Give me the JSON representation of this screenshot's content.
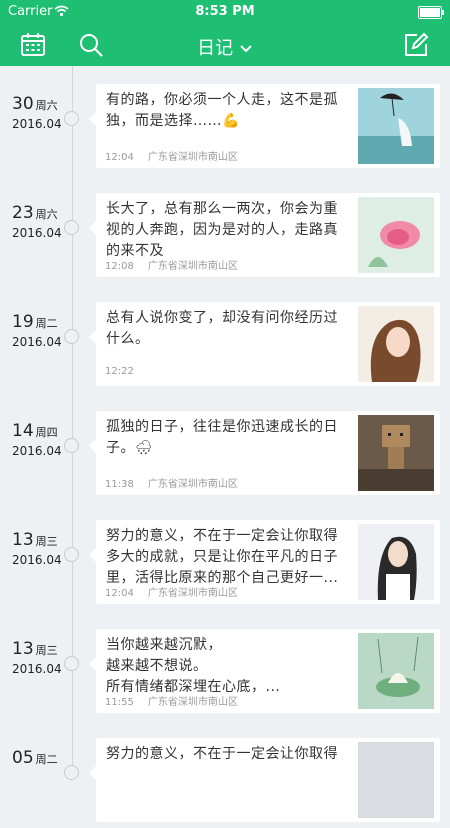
{
  "status_bar": {
    "carrier": "Carrier",
    "time": "8:53 PM"
  },
  "nav": {
    "title": "日记",
    "left_icons": [
      "calendar-icon",
      "search-icon"
    ],
    "right_icon": "edit-icon",
    "title_icon": "chevron-down-icon"
  },
  "colors": {
    "accent": "#1fbf73",
    "background": "#eef1f4"
  },
  "entries": [
    {
      "day": "30",
      "weekday": "周六",
      "year_month": "2016.04",
      "text": "有的路，你必须一个人走，这不是孤独，而是选择……💪",
      "time": "12:04",
      "location": "广东省深圳市南山区"
    },
    {
      "day": "23",
      "weekday": "周六",
      "year_month": "2016.04",
      "text": "长大了，总有那么一两次，你会为重视的人奔跑，因为是对的人，走路真的来不及",
      "time": "12:08",
      "location": "广东省深圳市南山区"
    },
    {
      "day": "19",
      "weekday": "周二",
      "year_month": "2016.04",
      "text": "总有人说你变了，却没有问你经历过什么。",
      "time": "12:22",
      "location": ""
    },
    {
      "day": "14",
      "weekday": "周四",
      "year_month": "2016.04",
      "text": "孤独的日子，往往是你迅速成长的日子。🌧",
      "time": "11:38",
      "location": "广东省深圳市南山区"
    },
    {
      "day": "13",
      "weekday": "周三",
      "year_month": "2016.04",
      "text": "努力的意义，不在于一定会让你取得多大的成就，只是让你在平凡的日子里，活得比原来的那个自己更好一...",
      "time": "12:04",
      "location": "广东省深圳市南山区"
    },
    {
      "day": "13",
      "weekday": "周三",
      "year_month": "2016.04",
      "text": "当你越来越沉默，\n越来越不想说。\n所有情绪都深埋在心底，...",
      "time": "11:55",
      "location": "广东省深圳市南山区"
    },
    {
      "day": "05",
      "weekday": "周二",
      "year_month": "",
      "text": "努力的意义，不在于一定会让你取得",
      "time": "",
      "location": ""
    }
  ]
}
